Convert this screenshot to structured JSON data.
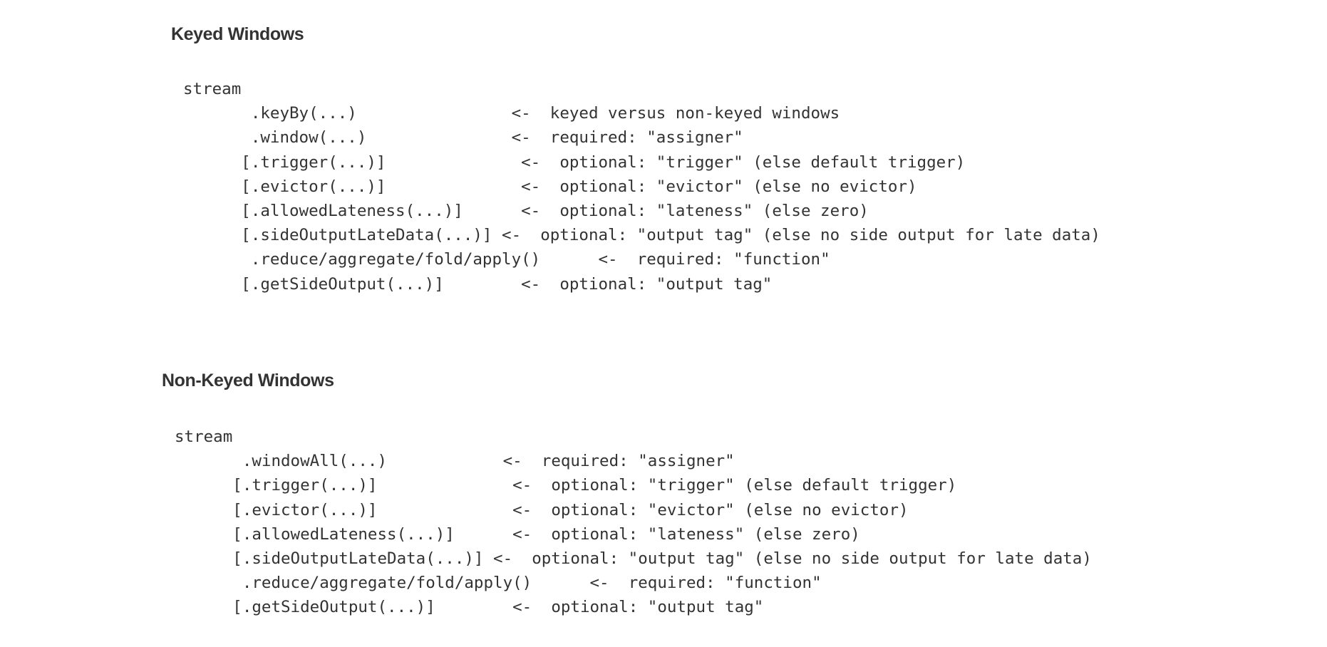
{
  "keyed": {
    "title": "Keyed Windows",
    "lines": [
      {
        "pad": "",
        "call": "stream",
        "gap": "",
        "arrow": "",
        "sp": "",
        "comment": ""
      },
      {
        "pad": "       ",
        "call": ".keyBy(...)",
        "gap": "                ",
        "arrow": "<-",
        "sp": "  ",
        "comment": "keyed versus non-keyed windows"
      },
      {
        "pad": "       ",
        "call": ".window(...)",
        "gap": "               ",
        "arrow": "<-",
        "sp": "  ",
        "comment": "required: \"assigner\""
      },
      {
        "pad": "      ",
        "call": "[.trigger(...)]",
        "gap": "              ",
        "arrow": "<-",
        "sp": "  ",
        "comment": "optional: \"trigger\" (else default trigger)"
      },
      {
        "pad": "      ",
        "call": "[.evictor(...)]",
        "gap": "              ",
        "arrow": "<-",
        "sp": "  ",
        "comment": "optional: \"evictor\" (else no evictor)"
      },
      {
        "pad": "      ",
        "call": "[.allowedLateness(...)]",
        "gap": "      ",
        "arrow": "<-",
        "sp": "  ",
        "comment": "optional: \"lateness\" (else zero)"
      },
      {
        "pad": "      ",
        "call": "[.sideOutputLateData(...)]",
        "gap": " ",
        "arrow": "<-",
        "sp": "  ",
        "comment": "optional: \"output tag\" (else no side output for late data)"
      },
      {
        "pad": "       ",
        "call": ".reduce/aggregate/fold/apply()",
        "gap": "      ",
        "arrow": "<-",
        "sp": "  ",
        "comment": "required: \"function\""
      },
      {
        "pad": "      ",
        "call": "[.getSideOutput(...)]",
        "gap": "        ",
        "arrow": "<-",
        "sp": "  ",
        "comment": "optional: \"output tag\""
      }
    ]
  },
  "non_keyed": {
    "title": "Non-Keyed Windows",
    "lines": [
      {
        "pad": "",
        "call": "stream",
        "gap": "",
        "arrow": "",
        "sp": "",
        "comment": ""
      },
      {
        "pad": "       ",
        "call": ".windowAll(...)",
        "gap": "            ",
        "arrow": "<-",
        "sp": "  ",
        "comment": "required: \"assigner\""
      },
      {
        "pad": "      ",
        "call": "[.trigger(...)]",
        "gap": "              ",
        "arrow": "<-",
        "sp": "  ",
        "comment": "optional: \"trigger\" (else default trigger)"
      },
      {
        "pad": "      ",
        "call": "[.evictor(...)]",
        "gap": "              ",
        "arrow": "<-",
        "sp": "  ",
        "comment": "optional: \"evictor\" (else no evictor)"
      },
      {
        "pad": "      ",
        "call": "[.allowedLateness(...)]",
        "gap": "      ",
        "arrow": "<-",
        "sp": "  ",
        "comment": "optional: \"lateness\" (else zero)"
      },
      {
        "pad": "      ",
        "call": "[.sideOutputLateData(...)]",
        "gap": " ",
        "arrow": "<-",
        "sp": "  ",
        "comment": "optional: \"output tag\" (else no side output for late data)"
      },
      {
        "pad": "       ",
        "call": ".reduce/aggregate/fold/apply()",
        "gap": "      ",
        "arrow": "<-",
        "sp": "  ",
        "comment": "required: \"function\""
      },
      {
        "pad": "      ",
        "call": "[.getSideOutput(...)]",
        "gap": "        ",
        "arrow": "<-",
        "sp": "  ",
        "comment": "optional: \"output tag\""
      }
    ]
  }
}
